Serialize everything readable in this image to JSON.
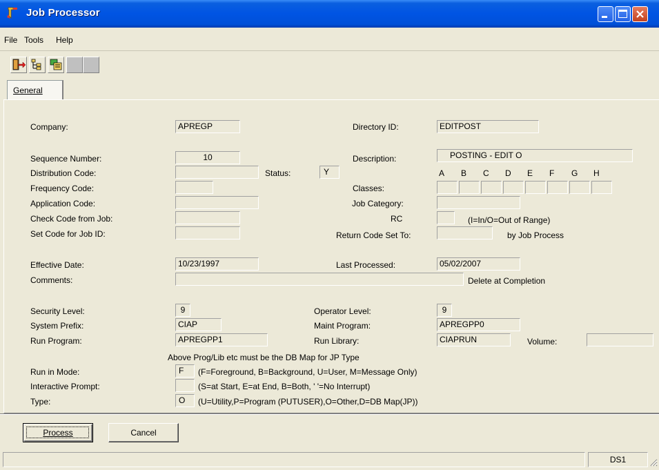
{
  "window": {
    "title": "Job Processor"
  },
  "menu": {
    "file": "File",
    "tools": "Tools",
    "help": "Help"
  },
  "toolbar": {
    "icons": [
      "exit-icon",
      "tree-icon",
      "run-icon",
      "disabled-icon",
      "disabled-icon"
    ]
  },
  "tabs": {
    "general": "General"
  },
  "form": {
    "company_label": "Company:",
    "company_value": "APREGP",
    "directory_label": "Directory ID:",
    "directory_value": "EDITPOST",
    "sequence_label": "Sequence Number:",
    "sequence_value": "10",
    "description_label": "Description:",
    "description_value": "POSTING - EDIT O",
    "distribution_label": "Distribution Code:",
    "distribution_value": "",
    "status_label": "Status:",
    "status_value": "Y",
    "class_letters": [
      "A",
      "B",
      "C",
      "D",
      "E",
      "F",
      "G",
      "H"
    ],
    "frequency_label": "Frequency Code:",
    "frequency_value": "",
    "classes_label": "Classes:",
    "application_label": "Application Code:",
    "application_value": "",
    "job_category_label": "Job Category:",
    "job_category_value": "",
    "check_code_label": "Check Code from Job:",
    "check_code_value": "",
    "rc_label": "RC",
    "rc_value": "",
    "rc_hint": "(I=In/O=Out of Range)",
    "set_code_label": "Set Code for Job ID:",
    "set_code_value": "",
    "return_code_label": "Return Code Set To:",
    "return_code_value": "",
    "by_job_process": "by Job Process",
    "effective_label": "Effective Date:",
    "effective_value": "10/23/1997",
    "last_processed_label": "Last Processed:",
    "last_processed_value": "05/02/2007",
    "comments_label": "Comments:",
    "comments_value": "",
    "delete_label": "Delete at Completion",
    "security_label": "Security Level:",
    "security_value": "9",
    "operator_label": "Operator Level:",
    "operator_value": "9",
    "system_prefix_label": "System Prefix:",
    "system_prefix_value": "CIAP",
    "maint_program_label": "Maint Program:",
    "maint_program_value": "APREGPP0",
    "run_program_label": "Run Program:",
    "run_program_value": "APREGPP1",
    "run_library_label": "Run Library:",
    "run_library_value": "CIAPRUN",
    "volume_label": "Volume:",
    "volume_value": "",
    "above_note": "Above Prog/Lib etc must be the DB Map for JP Type",
    "run_mode_label": "Run in Mode:",
    "run_mode_value": "F",
    "run_mode_hint": "(F=Foreground, B=Background, U=User, M=Message Only)",
    "interactive_label": "Interactive Prompt:",
    "interactive_value": "",
    "interactive_hint": "(S=at Start, E=at End, B=Both, ' '=No Interrupt)",
    "type_label": "Type:",
    "type_value": "O",
    "type_hint": "(U=Utility,P=Program (PUTUSER),O=Other,D=DB Map(JP))"
  },
  "buttons": {
    "process": "Process",
    "cancel": "Cancel"
  },
  "statusbar": {
    "left": "",
    "right": "DS1"
  },
  "colors": {
    "title_blue": "#0054e3",
    "window_bg": "#ece9d8",
    "close_red": "#c2421f"
  }
}
